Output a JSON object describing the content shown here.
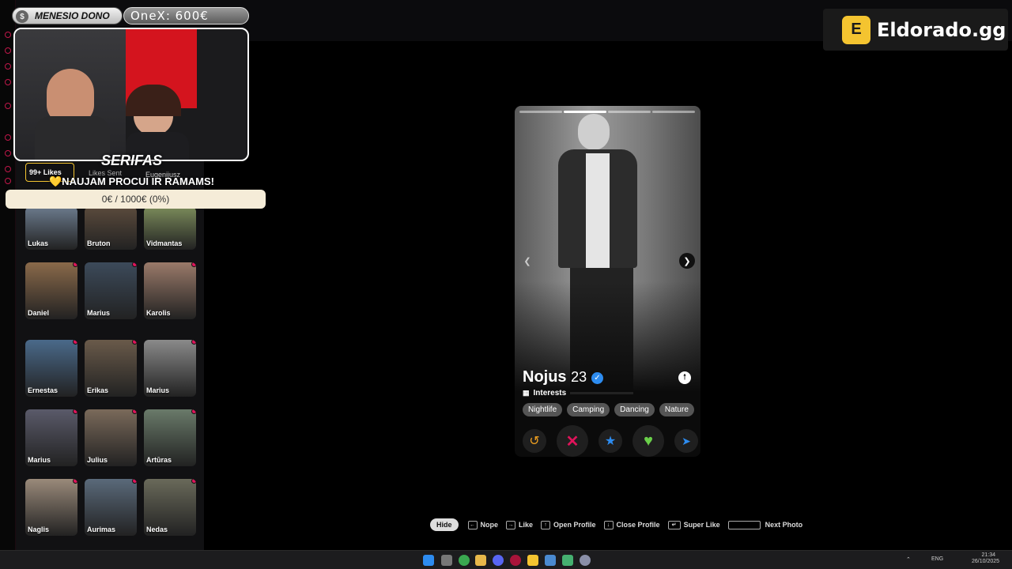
{
  "overlay": {
    "dono_label": "MENESIO DONO",
    "coin_symbol": "$",
    "onex_text": "OneX: 600€",
    "streamer_name": "SERIFAS",
    "goal_text": "💛NAUJAM PROCUI IR RAMAMS!",
    "goal_progress": "0€ / 1000€ (0%)",
    "goal_fraction": 0,
    "sponsor": "Eldorado.gg"
  },
  "sidebar": {
    "tabs": [
      "99+ Likes",
      "Likes Sent",
      "Eugenijusz"
    ],
    "rows": [
      [
        "Lukas",
        "Bruton",
        "Vidmantas"
      ],
      [
        "Daniel",
        "Marius",
        "Karolis"
      ],
      [
        "Ernestas",
        "Erikas",
        "Marius"
      ],
      [
        "Marius",
        "Julius",
        "Artūras"
      ],
      [
        "Naglis",
        "Aurimas",
        "Nedas"
      ]
    ]
  },
  "profile": {
    "name": "Nojus",
    "age": "23",
    "interests_label": "Interests",
    "tags": [
      "Nightlife",
      "Camping",
      "Dancing",
      "Nature"
    ],
    "photo_count": 4,
    "active_photo": 2
  },
  "hints": {
    "hide": "Hide",
    "nope": "Nope",
    "like": "Like",
    "open_profile": "Open Profile",
    "close_profile": "Close Profile",
    "super_like": "Super Like",
    "next_photo": "Next Photo"
  },
  "taskbar": {
    "lang": "ENG",
    "time": "21:34",
    "date": "26/10/2025"
  },
  "colors": {
    "accent": "#e0135a",
    "sponsor": "#f4c430",
    "like": "#6ad04a",
    "super": "#2d8cf0",
    "rewind": "#f0a020"
  }
}
